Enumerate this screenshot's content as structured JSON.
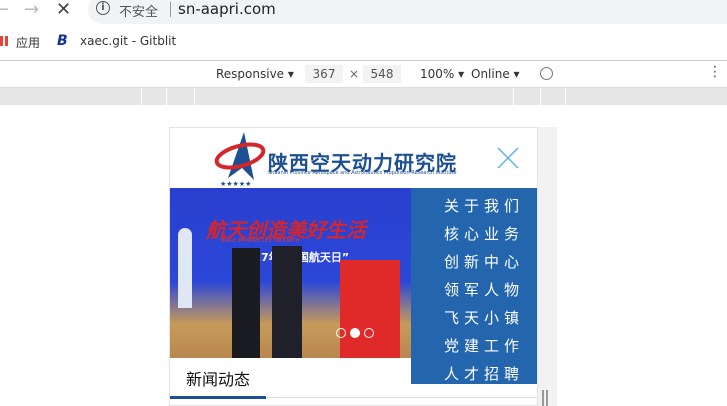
{
  "browser": {
    "insecure_label": "不安全",
    "url": "sn-aapri.com",
    "bookmarks": [
      {
        "label": "应用"
      },
      {
        "label": "xaec.git - Gitblit"
      }
    ]
  },
  "devtools": {
    "device": "Responsive",
    "width": "367",
    "times": "×",
    "height": "548",
    "zoom": "100%",
    "network": "Online"
  },
  "site": {
    "title": "陕西空天动力研究院",
    "subtitle": "Shaanxi Province Aerospace and Astronautics Propulsion Research Institute",
    "banner": {
      "slogan": "航天创造美好生活",
      "slogan_en": "SPACE IMPROVE LIFE ON EARTH",
      "headline": "2017年“中国航天日”",
      "active_slide": 2,
      "slide_count": 3
    },
    "menu": [
      "关于我们",
      "核心业务",
      "创新中心",
      "领军人物",
      "飞天小镇",
      "党建工作",
      "人才招聘"
    ],
    "section_title": "新闻动态"
  }
}
